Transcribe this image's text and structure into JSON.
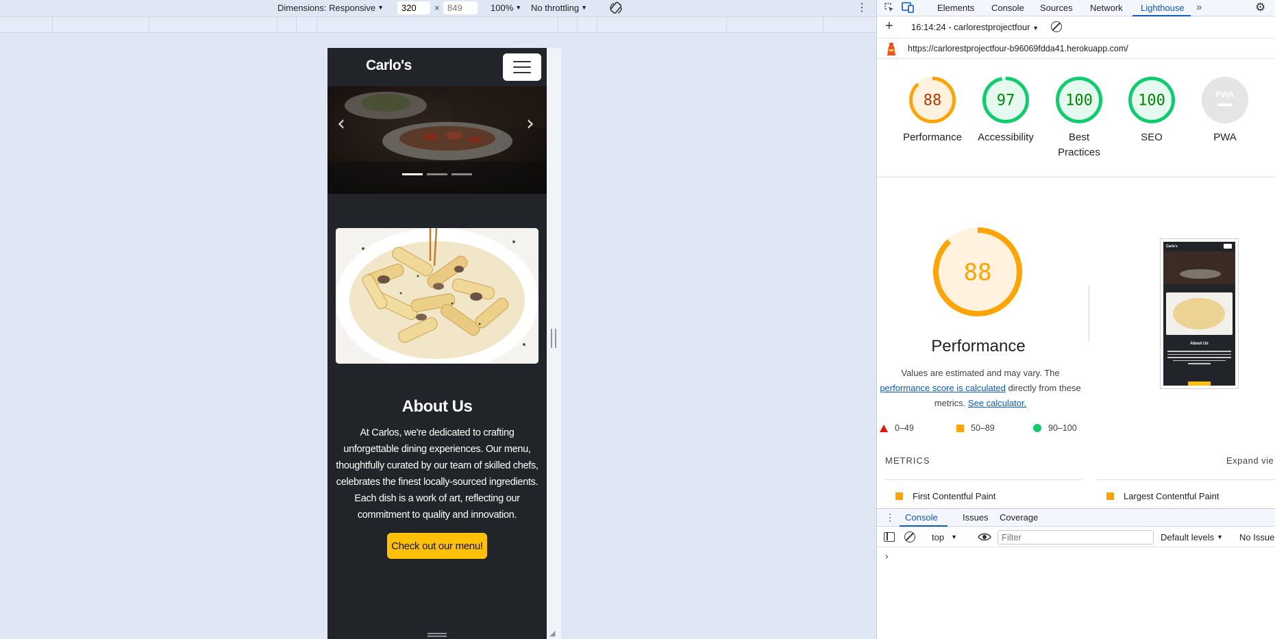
{
  "device_toolbar": {
    "dimensions_label": "Dimensions: Responsive",
    "width_value": "320",
    "height_placeholder": "849",
    "times": "×",
    "zoom": "100%",
    "throttling": "No throttling"
  },
  "site": {
    "brand": "Carlo's",
    "carousel_indicators": 3,
    "carousel_active_index": 0,
    "about_title": "About Us",
    "about_text": "At Carlos, we're dedicated to crafting unforgettable dining experiences. Our menu, thoughtfully curated by our team of skilled chefs, celebrates the finest locally-sourced ingredients. Each dish is a work of art, reflecting our commitment to quality and innovation.",
    "cta_label": "Check out our menu!",
    "colors": {
      "dark": "#212529",
      "cta": "#ffc107"
    }
  },
  "devtools": {
    "tabs": [
      "Elements",
      "Console",
      "Sources",
      "Network",
      "Lighthouse"
    ],
    "active_tab": "Lighthouse",
    "report_select": "16:14:24 - carlorestprojectfour",
    "url": "https://carlorestprojectfour-b96069fdda41.herokuapp.com/",
    "gauges": [
      {
        "label": "Performance",
        "score": "88",
        "value": 88,
        "color": "#ffa400",
        "text_color": "#c33300",
        "bg": "#fff3e0"
      },
      {
        "label": "Accessibility",
        "score": "97",
        "value": 97,
        "color": "#0cce6b",
        "text_color": "#008800",
        "bg": "#e6f9ef"
      },
      {
        "label": "Best Practices",
        "score": "100",
        "value": 100,
        "color": "#0cce6b",
        "text_color": "#008800",
        "bg": "#e6f9ef"
      },
      {
        "label": "SEO",
        "score": "100",
        "value": 100,
        "color": "#0cce6b",
        "text_color": "#008800",
        "bg": "#e6f9ef"
      },
      {
        "label": "PWA",
        "score": "PWA",
        "value": 0,
        "color": "#cccccc",
        "text_color": "#9e9e9e",
        "bg": "#e5e5e5"
      }
    ],
    "performance": {
      "score": "88",
      "value": 88,
      "title": "Performance",
      "desc_prefix": "Values are estimated and may vary. The",
      "desc_link1": "performance score is calculated",
      "desc_middle": "directly from these metrics.",
      "desc_link2": "See calculator.",
      "legend": [
        "0–49",
        "50–89",
        "90–100"
      ]
    },
    "metrics": {
      "title": "METRICS",
      "expand": "Expand vie",
      "items": [
        "First Contentful Paint",
        "Largest Contentful Paint"
      ]
    },
    "drawer": {
      "tabs": [
        "Console",
        "Issues",
        "Coverage"
      ],
      "context": "top",
      "filter_placeholder": "Filter",
      "levels": "Default levels",
      "issues": "No Issue"
    }
  }
}
